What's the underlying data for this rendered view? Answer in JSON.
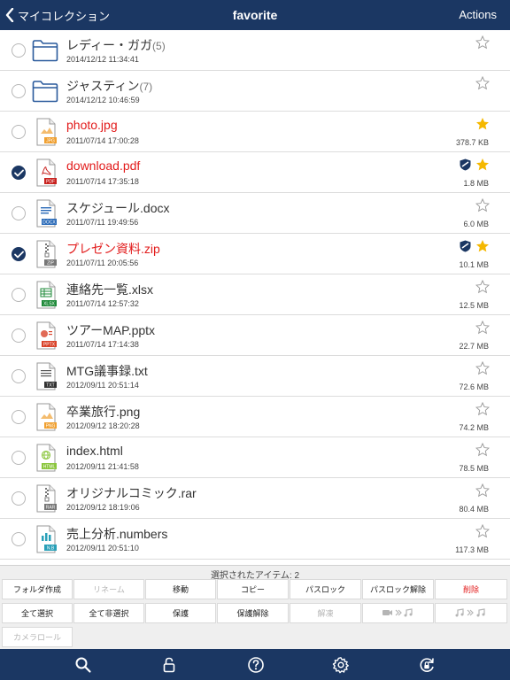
{
  "nav": {
    "back_label": "マイコレクション",
    "title": "favorite",
    "actions_label": "Actions"
  },
  "colors": {
    "nav_bg": "#1b3763",
    "star_active": "#f5b800",
    "highlight_text": "#e21b1b"
  },
  "items": [
    {
      "name": "レディー・ガガ",
      "count": "(5)",
      "date": "2014/12/12 11:34:41",
      "size": "",
      "type": "folder",
      "badge": "",
      "selected": false,
      "starred": false,
      "locked": false,
      "highlight": false
    },
    {
      "name": "ジャスティン",
      "count": "(7)",
      "date": "2014/12/12 10:46:59",
      "size": "",
      "type": "folder",
      "badge": "",
      "selected": false,
      "starred": false,
      "locked": false,
      "highlight": false
    },
    {
      "name": "photo.jpg",
      "count": "",
      "date": "2011/07/14 17:00:28",
      "size": "378.7 KB",
      "type": "image",
      "badge": "JPG",
      "badge_color": "#f0a030",
      "selected": false,
      "starred": true,
      "locked": false,
      "highlight": true
    },
    {
      "name": "download.pdf",
      "count": "",
      "date": "2011/07/14 17:35:18",
      "size": "1.8 MB",
      "type": "pdf",
      "badge": "PDF",
      "badge_color": "#c8221f",
      "selected": true,
      "starred": true,
      "locked": true,
      "highlight": true
    },
    {
      "name": "スケジュール.docx",
      "count": "",
      "date": "2011/07/11 19:49:56",
      "size": "6.0 MB",
      "type": "doc",
      "badge": "DOCX",
      "badge_color": "#2a6ab8",
      "selected": false,
      "starred": false,
      "locked": false,
      "highlight": false
    },
    {
      "name": "プレゼン資料.zip",
      "count": "",
      "date": "2011/07/11 20:05:56",
      "size": "10.1 MB",
      "type": "zip",
      "badge": "ZIP",
      "badge_color": "#777777",
      "selected": true,
      "starred": true,
      "locked": true,
      "highlight": true
    },
    {
      "name": "連絡先一覧.xlsx",
      "count": "",
      "date": "2011/07/14 12:57:32",
      "size": "12.5 MB",
      "type": "xls",
      "badge": "XLSX",
      "badge_color": "#1f8a3a",
      "selected": false,
      "starred": false,
      "locked": false,
      "highlight": false
    },
    {
      "name": "ツアーMAP.pptx",
      "count": "",
      "date": "2011/07/14 17:14:38",
      "size": "22.7 MB",
      "type": "ppt",
      "badge": "PPTX",
      "badge_color": "#d9432a",
      "selected": false,
      "starred": false,
      "locked": false,
      "highlight": false
    },
    {
      "name": "MTG議事録.txt",
      "count": "",
      "date": "2012/09/11 20:51:14",
      "size": "72.6 MB",
      "type": "txt",
      "badge": "TXT",
      "badge_color": "#333333",
      "selected": false,
      "starred": false,
      "locked": false,
      "highlight": false
    },
    {
      "name": "卒業旅行.png",
      "count": "",
      "date": "2012/09/12 18:20:28",
      "size": "74.2 MB",
      "type": "image",
      "badge": "PNG",
      "badge_color": "#f0a030",
      "selected": false,
      "starred": false,
      "locked": false,
      "highlight": false
    },
    {
      "name": "index.html",
      "count": "",
      "date": "2012/09/11 21:41:58",
      "size": "78.5 MB",
      "type": "html",
      "badge": "HTML",
      "badge_color": "#8cc63f",
      "selected": false,
      "starred": false,
      "locked": false,
      "highlight": false
    },
    {
      "name": "オリジナルコミック.rar",
      "count": "",
      "date": "2012/09/12 18:19:06",
      "size": "80.4 MB",
      "type": "rar",
      "badge": "RAR",
      "badge_color": "#777777",
      "selected": false,
      "starred": false,
      "locked": false,
      "highlight": false
    },
    {
      "name": "売上分析.numbers",
      "count": "",
      "date": "2012/09/11 20:51:10",
      "size": "117.3 MB",
      "type": "numbers",
      "badge": "N.B",
      "badge_color": "#2aa0b8",
      "selected": false,
      "starred": false,
      "locked": false,
      "highlight": false
    }
  ],
  "toolbar": {
    "selected_count": "選択されたアイテム: 2",
    "row1": [
      {
        "label": "フォルダ作成",
        "name": "create-folder-button",
        "state": "normal"
      },
      {
        "label": "リネーム",
        "name": "rename-button",
        "state": "disabled"
      },
      {
        "label": "移動",
        "name": "move-button",
        "state": "normal"
      },
      {
        "label": "コピー",
        "name": "copy-button",
        "state": "normal"
      },
      {
        "label": "パスロック",
        "name": "passlock-button",
        "state": "normal"
      },
      {
        "label": "パスロック解除",
        "name": "passlock-release-button",
        "state": "normal"
      },
      {
        "label": "削除",
        "name": "delete-button",
        "state": "danger"
      }
    ],
    "row2": [
      {
        "label": "全て選択",
        "name": "select-all-button",
        "state": "normal"
      },
      {
        "label": "全て非選択",
        "name": "deselect-all-button",
        "state": "normal"
      },
      {
        "label": "保護",
        "name": "protect-button",
        "state": "normal"
      },
      {
        "label": "保護解除",
        "name": "unprotect-button",
        "state": "normal"
      },
      {
        "label": "解凍",
        "name": "extract-button",
        "state": "disabled"
      },
      {
        "label": "",
        "name": "video-to-audio-button",
        "state": "disabled",
        "icon": "video-to-music-icon"
      },
      {
        "label": "",
        "name": "audio-convert-button",
        "state": "disabled",
        "icon": "music-to-music-icon"
      }
    ],
    "row3": [
      {
        "label": "カメラロール",
        "name": "camera-roll-button",
        "state": "disabled"
      }
    ]
  },
  "tabbar": [
    {
      "name": "tab-search",
      "icon": "search-icon"
    },
    {
      "name": "tab-lock",
      "icon": "lock-icon"
    },
    {
      "name": "tab-help",
      "icon": "help-icon"
    },
    {
      "name": "tab-settings",
      "icon": "gear-icon"
    },
    {
      "name": "tab-refresh-lock",
      "icon": "refresh-lock-icon"
    }
  ]
}
